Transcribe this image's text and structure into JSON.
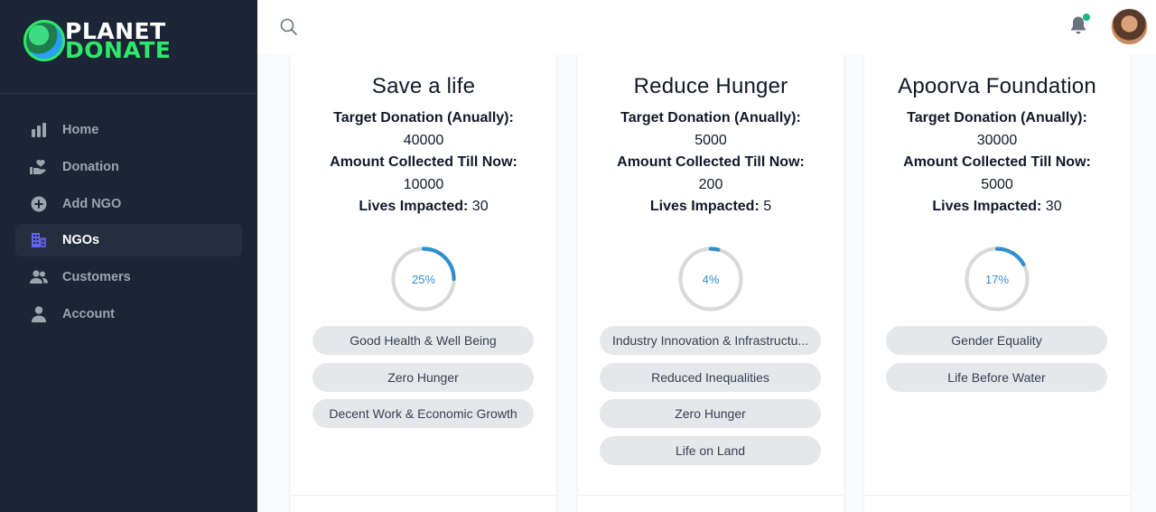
{
  "brand": {
    "line1": "PLANET",
    "line2": "DONATE"
  },
  "sidebar": {
    "items": [
      {
        "label": "Home",
        "icon": "bar-chart-icon",
        "active": false
      },
      {
        "label": "Donation",
        "icon": "hand-heart-icon",
        "active": false
      },
      {
        "label": "Add NGO",
        "icon": "plus-circle-icon",
        "active": false
      },
      {
        "label": "NGOs",
        "icon": "building-icon",
        "active": true
      },
      {
        "label": "Customers",
        "icon": "users-icon",
        "active": false
      },
      {
        "label": "Account",
        "icon": "user-icon",
        "active": false
      }
    ]
  },
  "topbar": {
    "search_icon": "search-icon",
    "notification_icon": "bell-icon",
    "notification_dot": true
  },
  "labels": {
    "target": "Target Donation (Anually):",
    "collected": "Amount Collected Till Now:",
    "lives": "Lives Impacted:"
  },
  "cards": [
    {
      "title": "Save a life",
      "target": "40000",
      "collected": "10000",
      "lives": "30",
      "progress_label": "25%",
      "progress": 0.25,
      "tags": [
        "Good Health & Well Being",
        "Zero Hunger",
        "Decent Work & Economic Growth"
      ]
    },
    {
      "title": "Reduce Hunger",
      "target": "5000",
      "collected": "200",
      "lives": "5",
      "progress_label": "4%",
      "progress": 0.04,
      "tags": [
        "Industry Innovation & Infrastructu...",
        "Reduced Inequalities",
        "Zero Hunger",
        "Life on Land"
      ]
    },
    {
      "title": "Apoorva Foundation",
      "target": "30000",
      "collected": "5000",
      "lives": "30",
      "progress_label": "17%",
      "progress": 0.17,
      "tags": [
        "Gender Equality",
        "Life Before Water"
      ]
    }
  ],
  "colors": {
    "sidebar_bg": "#1c2536",
    "accent_green": "#2ee86a",
    "progress_blue": "#2f8fce",
    "progress_track": "#d9d9d9",
    "nav_active_icon": "#6366f1"
  }
}
